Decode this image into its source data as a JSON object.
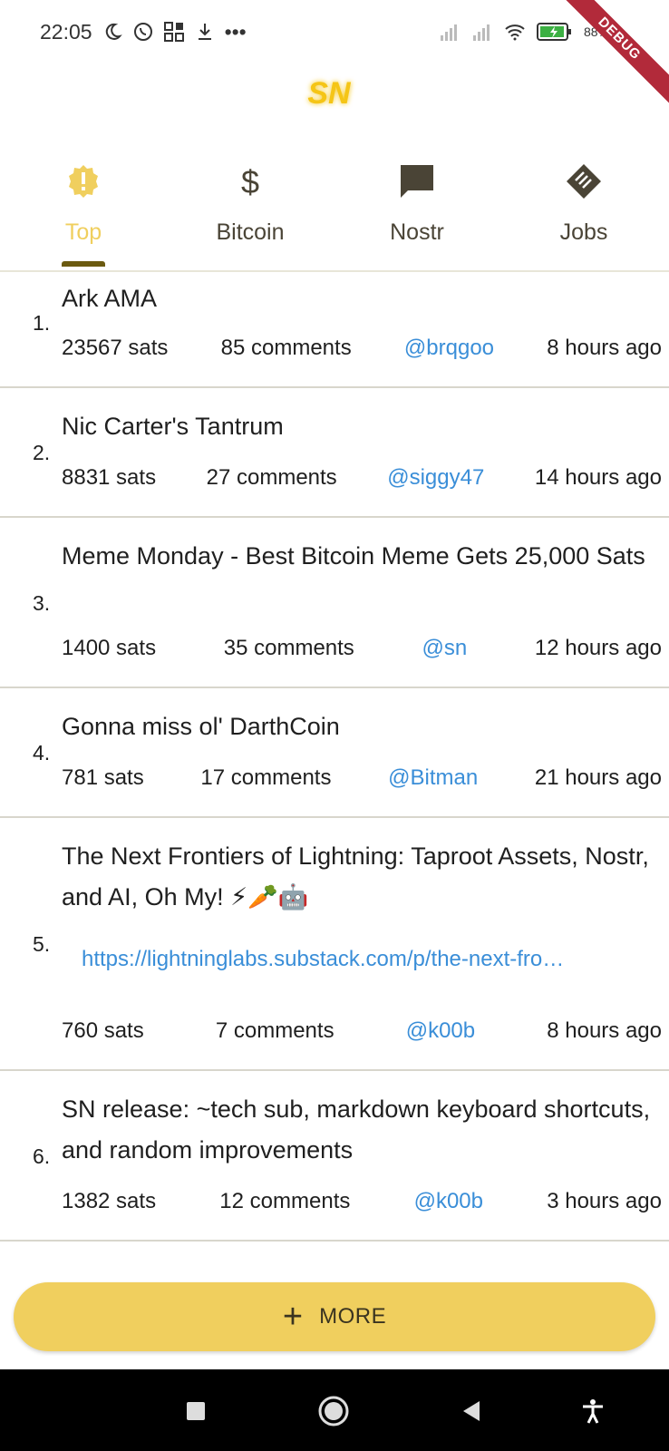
{
  "status_bar": {
    "time": "22:05",
    "battery": "88%",
    "icons": [
      "moon-icon",
      "whatsapp-icon",
      "qr-icon",
      "download-icon",
      "more-dots-icon",
      "signal-icon",
      "signal-icon",
      "wifi-icon",
      "battery-charging-icon"
    ]
  },
  "debug_banner": "DEBUG",
  "app": {
    "logo_text": "SN",
    "accent": "#f0cf5e"
  },
  "tabs": [
    {
      "label": "Top",
      "icon": "alert-badge-icon",
      "active": true
    },
    {
      "label": "Bitcoin",
      "icon": "dollar-icon",
      "active": false
    },
    {
      "label": "Nostr",
      "icon": "chat-icon",
      "active": false
    },
    {
      "label": "Jobs",
      "icon": "jobs-icon",
      "active": false
    }
  ],
  "items": [
    {
      "num": "1.",
      "title": "Ark AMA",
      "sats": "23567 sats",
      "comments": "85 comments",
      "user": "@brqgoo",
      "time": "8 hours ago"
    },
    {
      "num": "2.",
      "title": "Nic Carter's Tantrum",
      "sats": "8831 sats",
      "comments": "27 comments",
      "user": "@siggy47",
      "time": "14 hours ago"
    },
    {
      "num": "3.",
      "title": "Meme Monday - Best Bitcoin Meme Gets 25,000 Sats",
      "sats": "1400 sats",
      "comments": "35 comments",
      "user": "@sn",
      "time": "12 hours ago"
    },
    {
      "num": "4.",
      "title": "Gonna miss ol' DarthCoin",
      "sats": "781 sats",
      "comments": "17 comments",
      "user": "@Bitman",
      "time": "21 hours ago"
    },
    {
      "num": "5.",
      "title": "The Next Frontiers of Lightning: Taproot Assets, Nostr, and AI, Oh My! ⚡🥕🤖",
      "link": "https://lightninglabs.substack.com/p/the-next-fro…",
      "sats": "760 sats",
      "comments": "7 comments",
      "user": "@k00b",
      "time": "8 hours ago"
    },
    {
      "num": "6.",
      "title": "SN release: ~tech sub, markdown keyboard shortcuts, and random improvements",
      "sats": "1382 sats",
      "comments": "12 comments",
      "user": "@k00b",
      "time": "3 hours ago"
    }
  ],
  "more_button": {
    "label": "MORE",
    "icon": "plus-icon"
  },
  "nav": {
    "buttons": [
      "recents-icon",
      "home-icon",
      "back-icon",
      "accessibility-icon"
    ]
  }
}
